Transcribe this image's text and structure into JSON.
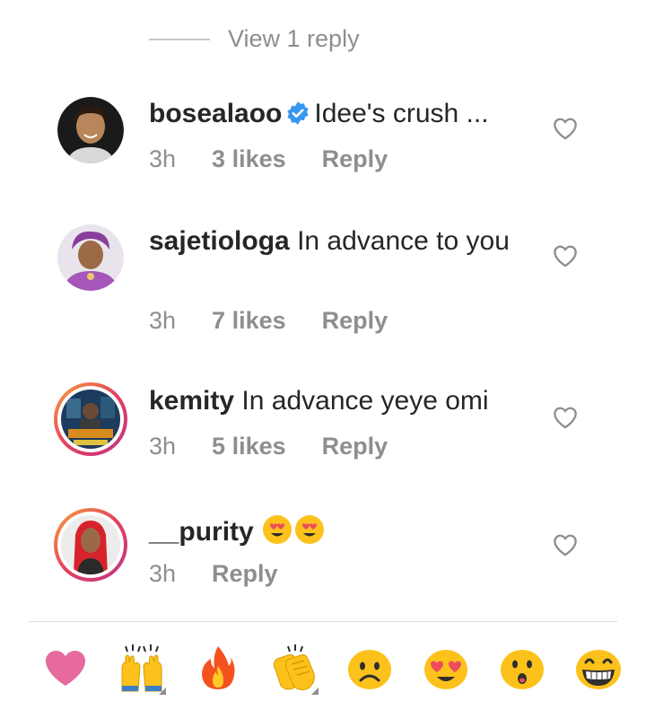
{
  "thread": {
    "view_replies_label": "View 1 reply"
  },
  "comments": [
    {
      "username": "bosealaoo",
      "verified": true,
      "text": "Idee's crush ...",
      "time": "3h",
      "likes": "3 likes",
      "reply": "Reply"
    },
    {
      "username": "sajetiologa",
      "text": "In advance to you",
      "time": "3h",
      "likes": "7 likes",
      "reply": "Reply"
    },
    {
      "username": "kemity",
      "text": "In advance yeye omi",
      "time": "3h",
      "likes": "5 likes",
      "reply": "Reply"
    },
    {
      "username": "__purity",
      "text": "",
      "time": "3h",
      "reply": "Reply"
    }
  ],
  "emoji_bar": {
    "items": [
      "heart",
      "raised-hands",
      "fire",
      "clapping-hands",
      "sad-face",
      "heart-eyes-face",
      "surprised-face",
      "grinning-face"
    ]
  },
  "colors": {
    "muted": "#8e8e8e",
    "verified_blue": "#3897f0",
    "text": "#262626"
  }
}
